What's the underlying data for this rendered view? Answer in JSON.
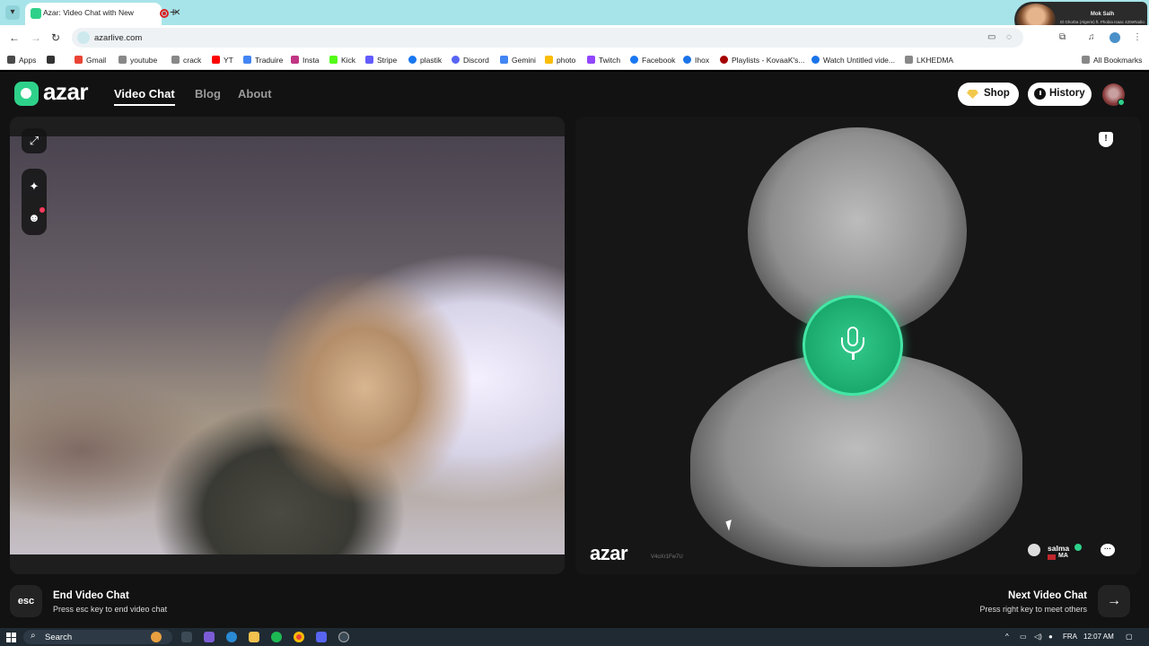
{
  "browser": {
    "tab_title": "Azar: Video Chat with New",
    "url": "azarlive.com",
    "profile_popup": {
      "name": "Mok Salh",
      "subtitle": "El Ghorba (Algerie) ft. Phobia Isaac 420eRadio"
    },
    "bookmarks": [
      {
        "label": "Apps",
        "color": "#4a4a4a"
      },
      {
        "label": "Gmail",
        "color": "#ea4335"
      },
      {
        "label": "youtube",
        "color": "#888888"
      },
      {
        "label": "crack",
        "color": "#888888"
      },
      {
        "label": "YT",
        "color": "#ff0000"
      },
      {
        "label": "Traduire",
        "color": "#4285f4"
      },
      {
        "label": "Insta",
        "color": "#c13584"
      },
      {
        "label": "Kick",
        "color": "#53fc18"
      },
      {
        "label": "Stripe",
        "color": "#635bff"
      },
      {
        "label": "plastik",
        "color": "#1877f2"
      },
      {
        "label": "Discord",
        "color": "#5865f2"
      },
      {
        "label": "Gemini",
        "color": "#4285f4"
      },
      {
        "label": "photo",
        "color": "#fbbc04"
      },
      {
        "label": "Twitch",
        "color": "#9146ff"
      },
      {
        "label": "Facebook",
        "color": "#1877f2"
      },
      {
        "label": "Ihox",
        "color": "#1a73e8"
      },
      {
        "label": "Playlists - KovaaK's...",
        "color": "#a50000"
      },
      {
        "label": "Watch Untitled vide...",
        "color": "#1a73e8"
      },
      {
        "label": "LKHEDMA",
        "color": "#888888"
      }
    ],
    "all_bookmarks": "All Bookmarks"
  },
  "azar": {
    "logo": "azar",
    "nav": {
      "video_chat": "Video Chat",
      "blog": "Blog",
      "about": "About"
    },
    "shop_label": "Shop",
    "history_label": "History",
    "peer": {
      "watermark_logo": "azar",
      "session_id": "V4oXr1Fw7U",
      "name": "salma",
      "country": "MA"
    },
    "controls": {
      "esc_key": "esc",
      "end_title": "End Video Chat",
      "end_sub": "Press esc key to end video chat",
      "next_title": "Next Video Chat",
      "next_sub": "Press right key to meet others"
    },
    "colors": {
      "accent": "#2ed18a",
      "background": "#121212"
    }
  },
  "taskbar": {
    "search_placeholder": "Search",
    "language": "FRA",
    "time": "12:07 AM"
  }
}
